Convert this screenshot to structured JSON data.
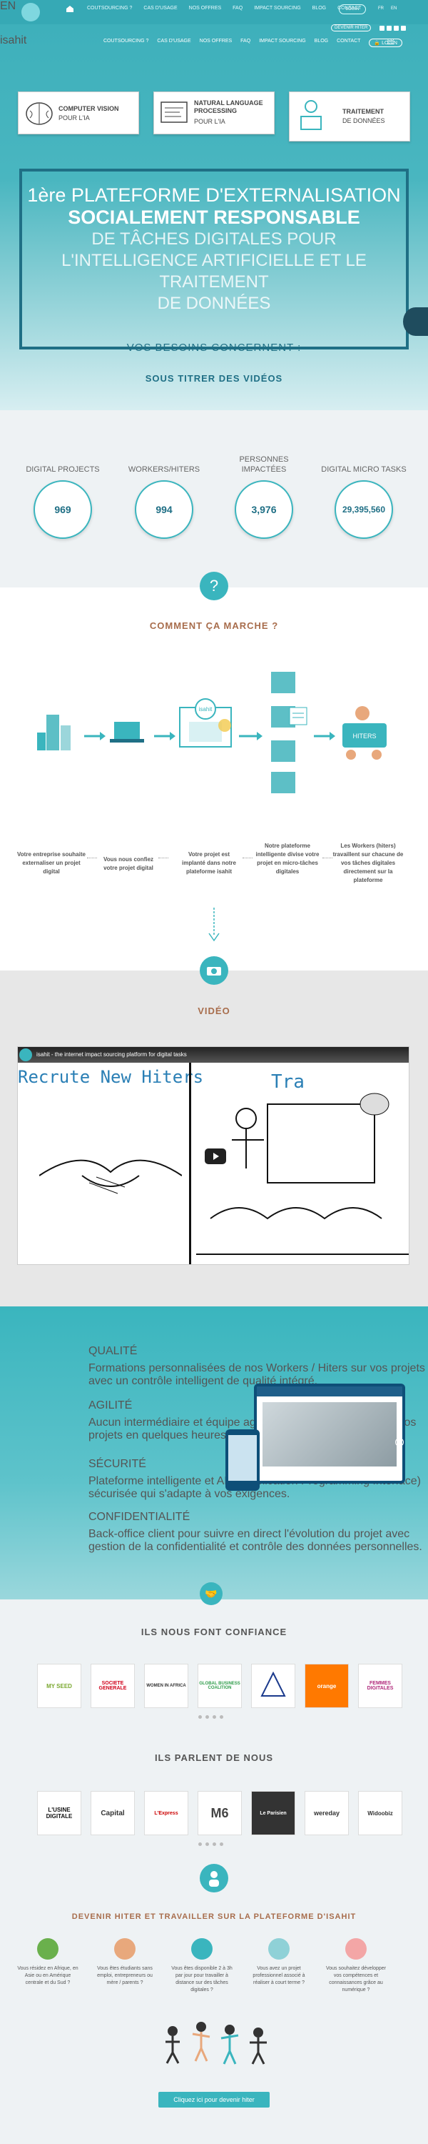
{
  "topbar": {
    "nav": [
      "COUTSOURCING ?",
      "CAS D'USAGE",
      "NOS OFFRES",
      "FAQ",
      "IMPACT SOURCING",
      "BLOG",
      "CONTACT"
    ],
    "login": "LOGIN",
    "langs": [
      "FR",
      "EN"
    ]
  },
  "header": {
    "logo": "isahit",
    "lang_en": "EN",
    "nav": [
      "COUTSOURCING ?",
      "CAS D'USAGE",
      "NOS OFFRES",
      "FAQ",
      "IMPACT SOURCING",
      "BLOG",
      "CONTACT"
    ],
    "login": "LOGIN",
    "devenir": "DEVENIR HITER",
    "lang_fr": "FR"
  },
  "cards": [
    {
      "title": "COMPUTER VISION",
      "sub": "POUR L'IA"
    },
    {
      "title": "NATURAL LANGUAGE PROCESSING",
      "sub": "POUR L'IA"
    },
    {
      "title": "TRAITEMENT",
      "sub": "DE DONNÉES"
    }
  ],
  "hero": {
    "line1": "1ère PLATEFORME D'EXTERNALISATION",
    "line2": "SOCIALEMENT RESPONSABLE",
    "line3": "DE TÂCHES DIGITALES POUR",
    "line4": "L'INTELLIGENCE ARTIFICIELLE ET LE TRAITEMENT",
    "line5": "DE DONNÉES",
    "besoins": "VOS BESOINS CONCERNENT :",
    "sous_titrer": "SOUS TITRER DES VIDÉOS"
  },
  "stats": [
    {
      "label": "DIGITAL PROJECTS",
      "value": "969"
    },
    {
      "label": "WORKERS/HITERS",
      "value": "994"
    },
    {
      "label": "PERSONNES IMPACTÉES",
      "value": "3,976"
    },
    {
      "label": "DIGITAL MICRO TASKS",
      "value": "29,395,560"
    }
  ],
  "how": {
    "icon": "?",
    "title": "COMMENT ÇA MARCHE ?",
    "steps": [
      "Votre entreprise souhaite externaliser un projet digital",
      "Vous nous confiez votre projet digital",
      "Votre projet est implanté dans notre plateforme isahit",
      "Notre plateforme intelligente divise votre projet en micro-tâches digitales",
      "Les Workers (hiters) travaillent sur chacune de vos tâches digitales directement sur la plateforme"
    ],
    "diagram_label": "isahit",
    "hiters_label": "HITERS"
  },
  "video": {
    "title": "VIDÉO",
    "bar_text": "isahit - the internet impact sourcing platform for digital tasks",
    "left_text": "Recrute New Hiters",
    "right_text": "Tra"
  },
  "features": [
    {
      "title": "QUALITÉ",
      "desc": "Formations personnalisées de nos Workers / Hiters sur vos projets avec un contrôle intelligent de qualité intégré."
    },
    {
      "title": "AGILITÉ",
      "desc": "Aucun intermédiaire et équipe agile, la plateforme s'adapte à vos projets en quelques heures et en quelques clics."
    },
    {
      "title": "SÉCURITÉ",
      "desc": "Plateforme intelligente et API (Application Programming Interface) sécurisée qui s'adapte à vos exigences."
    },
    {
      "title": "CONFIDENTIALITÉ",
      "desc": "Back-office client pour suivre en direct l'évolution du projet avec gestion de la confidentialité et contrôle des données personnelles."
    }
  ],
  "confiance": {
    "title": "ILS NOUS FONT CONFIANCE",
    "logos": [
      "MY SEED",
      "SOCIETE GENERALE",
      "WOMEN IN AFRICA",
      "GLOBAL BUSINESS COALITION",
      "",
      "orange",
      "FEMMES DIGITALES"
    ]
  },
  "parlent": {
    "title": "ILS PARLENT DE NOUS",
    "logos": [
      "L'USINE DIGITALE",
      "Capital",
      "L'Express",
      "M6",
      "Le Parisien",
      "wereday",
      "Widoobiz"
    ]
  },
  "hiter": {
    "title": "DEVENIR HITER ET TRAVAILLER SUR LA PLATEFORME D'ISAHIT",
    "items": [
      "Vous résidez en Afrique, en Asie ou en Amérique centrale et du Sud ?",
      "Vous êtes étudiants sans emploi, entrepreneurs ou mère / parents ?",
      "Vous êtes disponible 2 à 3h par jour pour travailler à distance sur des tâches digitales ?",
      "Vous avez un projet professionnel associé à réaliser à court terme ?",
      "Vous souhaitez développer vos compétences et connaissances grâce au numérique ?"
    ],
    "cta": "Cliquez ici pour devenir hiter"
  },
  "colors": {
    "teal": "#3ab5be",
    "dark_teal": "#1f6f85",
    "brown": "#a86d4c"
  }
}
